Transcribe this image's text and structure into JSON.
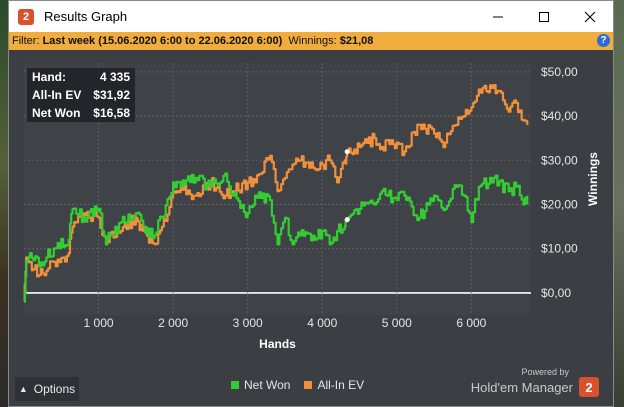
{
  "window": {
    "title": "Results Graph",
    "app_icon_text": "2"
  },
  "filter": {
    "label": "Filter:",
    "range": "Last week (15.06.2020 6:00 to 22.06.2020 6:00)",
    "winnings_label": "Winnings:",
    "winnings_value": "$21,08"
  },
  "stats": [
    {
      "label": "Hand:",
      "value": "4 335"
    },
    {
      "label": "All-In EV",
      "value": "$31,92"
    },
    {
      "label": "Net Won",
      "value": "$16,58"
    }
  ],
  "options": {
    "label": "Options"
  },
  "legend": [
    {
      "label": "Net Won",
      "color": "#33cc33"
    },
    {
      "label": "All-In EV",
      "color": "#f0903c"
    }
  ],
  "brand": {
    "powered_by": "Powered by",
    "name": "Hold'em Manager",
    "badge": "2"
  },
  "colors": {
    "filter_bar": "#f0ac3c",
    "net_won": "#33cc33",
    "all_in_ev": "#f0903c",
    "zero_line": "#ffffff"
  },
  "chart_data": {
    "type": "line",
    "xlabel": "Hands",
    "ylabel": "Winnings",
    "xlim": [
      0,
      6800
    ],
    "ylim": [
      -5,
      52
    ],
    "x_ticks": [
      1000,
      2000,
      3000,
      4000,
      5000,
      6000
    ],
    "x_tick_labels": [
      "1 000",
      "2 000",
      "3 000",
      "4 000",
      "5 000",
      "6 000"
    ],
    "y_ticks": [
      0,
      10,
      20,
      30,
      40,
      50
    ],
    "y_tick_labels": [
      "$0,00",
      "$10,00",
      "$20,00",
      "$30,00",
      "$40,00",
      "$50,00"
    ],
    "y_axis_side": "right",
    "grid": true,
    "series": [
      {
        "name": "Net Won",
        "color": "#33cc33",
        "x": [
          0,
          30,
          80,
          200,
          300,
          400,
          600,
          650,
          800,
          1000,
          1100,
          1150,
          1300,
          1500,
          1600,
          1750,
          1850,
          2000,
          2100,
          2300,
          2500,
          2700,
          2800,
          3000,
          3100,
          3300,
          3400,
          3500,
          3600,
          3700,
          3900,
          4000,
          4100,
          4200,
          4300,
          4335,
          4500,
          4700,
          4800,
          5000,
          5100,
          5300,
          5500,
          5650,
          5800,
          5900,
          6000,
          6100,
          6300,
          6500,
          6600,
          6700,
          6750
        ],
        "y": [
          -2,
          7,
          9,
          6,
          8,
          10,
          12,
          19,
          17,
          19,
          11,
          13,
          16,
          18,
          15,
          13,
          17,
          25,
          24,
          26,
          24,
          27,
          22,
          18,
          22,
          21,
          11,
          17,
          11,
          13,
          12,
          14,
          11,
          14,
          15,
          16.58,
          19,
          20,
          23,
          21,
          22,
          17,
          22,
          19,
          24,
          22,
          16,
          24,
          26,
          23,
          24,
          20,
          22
        ]
      },
      {
        "name": "All-In EV",
        "color": "#f0903c",
        "x": [
          0,
          30,
          80,
          200,
          300,
          400,
          600,
          650,
          800,
          1000,
          1100,
          1150,
          1300,
          1500,
          1600,
          1750,
          1850,
          2000,
          2100,
          2300,
          2500,
          2700,
          2800,
          3000,
          3100,
          3300,
          3400,
          3500,
          3600,
          3700,
          3900,
          4000,
          4100,
          4200,
          4300,
          4335,
          4500,
          4700,
          4800,
          5000,
          5100,
          5300,
          5500,
          5650,
          5800,
          5900,
          6000,
          6100,
          6300,
          6500,
          6600,
          6700,
          6750
        ],
        "y": [
          -2,
          8,
          7,
          4,
          5,
          7,
          9,
          15,
          18,
          17,
          11,
          13,
          14,
          17,
          14,
          11,
          15,
          23,
          24,
          22,
          25,
          22,
          23,
          25,
          25,
          31,
          23,
          26,
          29,
          30,
          28,
          29,
          30,
          25,
          30,
          31.92,
          33,
          35,
          33,
          34,
          32,
          38,
          36,
          34,
          38,
          40,
          42,
          46,
          47,
          41,
          43,
          39,
          38
        ]
      }
    ],
    "markers": [
      {
        "series": "Net Won",
        "x": 4335,
        "y": 16.58
      },
      {
        "series": "All-In EV",
        "x": 4335,
        "y": 31.92
      }
    ]
  }
}
